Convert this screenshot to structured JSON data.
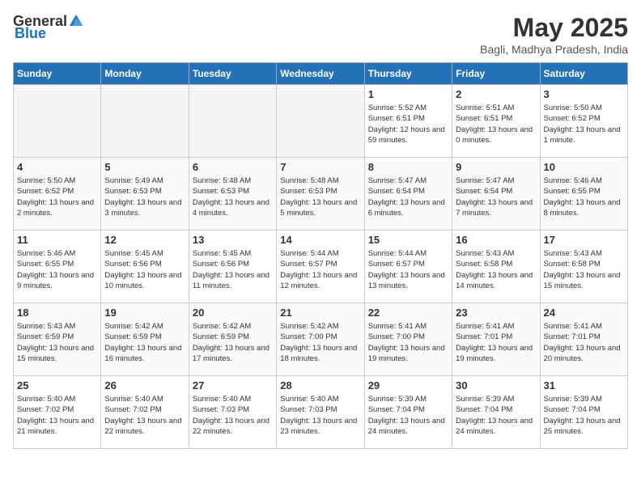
{
  "header": {
    "logo_general": "General",
    "logo_blue": "Blue",
    "month_year": "May 2025",
    "location": "Bagli, Madhya Pradesh, India"
  },
  "weekdays": [
    "Sunday",
    "Monday",
    "Tuesday",
    "Wednesday",
    "Thursday",
    "Friday",
    "Saturday"
  ],
  "weeks": [
    [
      {
        "day": "",
        "empty": true
      },
      {
        "day": "",
        "empty": true
      },
      {
        "day": "",
        "empty": true
      },
      {
        "day": "",
        "empty": true
      },
      {
        "day": "1",
        "sunrise": "5:52 AM",
        "sunset": "6:51 PM",
        "daylight": "12 hours and 59 minutes."
      },
      {
        "day": "2",
        "sunrise": "5:51 AM",
        "sunset": "6:51 PM",
        "daylight": "13 hours and 0 minutes."
      },
      {
        "day": "3",
        "sunrise": "5:50 AM",
        "sunset": "6:52 PM",
        "daylight": "13 hours and 1 minute."
      }
    ],
    [
      {
        "day": "4",
        "sunrise": "5:50 AM",
        "sunset": "6:52 PM",
        "daylight": "13 hours and 2 minutes."
      },
      {
        "day": "5",
        "sunrise": "5:49 AM",
        "sunset": "6:53 PM",
        "daylight": "13 hours and 3 minutes."
      },
      {
        "day": "6",
        "sunrise": "5:48 AM",
        "sunset": "6:53 PM",
        "daylight": "13 hours and 4 minutes."
      },
      {
        "day": "7",
        "sunrise": "5:48 AM",
        "sunset": "6:53 PM",
        "daylight": "13 hours and 5 minutes."
      },
      {
        "day": "8",
        "sunrise": "5:47 AM",
        "sunset": "6:54 PM",
        "daylight": "13 hours and 6 minutes."
      },
      {
        "day": "9",
        "sunrise": "5:47 AM",
        "sunset": "6:54 PM",
        "daylight": "13 hours and 7 minutes."
      },
      {
        "day": "10",
        "sunrise": "5:46 AM",
        "sunset": "6:55 PM",
        "daylight": "13 hours and 8 minutes."
      }
    ],
    [
      {
        "day": "11",
        "sunrise": "5:46 AM",
        "sunset": "6:55 PM",
        "daylight": "13 hours and 9 minutes."
      },
      {
        "day": "12",
        "sunrise": "5:45 AM",
        "sunset": "6:56 PM",
        "daylight": "13 hours and 10 minutes."
      },
      {
        "day": "13",
        "sunrise": "5:45 AM",
        "sunset": "6:56 PM",
        "daylight": "13 hours and 11 minutes."
      },
      {
        "day": "14",
        "sunrise": "5:44 AM",
        "sunset": "6:57 PM",
        "daylight": "13 hours and 12 minutes."
      },
      {
        "day": "15",
        "sunrise": "5:44 AM",
        "sunset": "6:57 PM",
        "daylight": "13 hours and 13 minutes."
      },
      {
        "day": "16",
        "sunrise": "5:43 AM",
        "sunset": "6:58 PM",
        "daylight": "13 hours and 14 minutes."
      },
      {
        "day": "17",
        "sunrise": "5:43 AM",
        "sunset": "6:58 PM",
        "daylight": "13 hours and 15 minutes."
      }
    ],
    [
      {
        "day": "18",
        "sunrise": "5:43 AM",
        "sunset": "6:59 PM",
        "daylight": "13 hours and 15 minutes."
      },
      {
        "day": "19",
        "sunrise": "5:42 AM",
        "sunset": "6:59 PM",
        "daylight": "13 hours and 16 minutes."
      },
      {
        "day": "20",
        "sunrise": "5:42 AM",
        "sunset": "6:59 PM",
        "daylight": "13 hours and 17 minutes."
      },
      {
        "day": "21",
        "sunrise": "5:42 AM",
        "sunset": "7:00 PM",
        "daylight": "13 hours and 18 minutes."
      },
      {
        "day": "22",
        "sunrise": "5:41 AM",
        "sunset": "7:00 PM",
        "daylight": "13 hours and 19 minutes."
      },
      {
        "day": "23",
        "sunrise": "5:41 AM",
        "sunset": "7:01 PM",
        "daylight": "13 hours and 19 minutes."
      },
      {
        "day": "24",
        "sunrise": "5:41 AM",
        "sunset": "7:01 PM",
        "daylight": "13 hours and 20 minutes."
      }
    ],
    [
      {
        "day": "25",
        "sunrise": "5:40 AM",
        "sunset": "7:02 PM",
        "daylight": "13 hours and 21 minutes."
      },
      {
        "day": "26",
        "sunrise": "5:40 AM",
        "sunset": "7:02 PM",
        "daylight": "13 hours and 22 minutes."
      },
      {
        "day": "27",
        "sunrise": "5:40 AM",
        "sunset": "7:03 PM",
        "daylight": "13 hours and 22 minutes."
      },
      {
        "day": "28",
        "sunrise": "5:40 AM",
        "sunset": "7:03 PM",
        "daylight": "13 hours and 23 minutes."
      },
      {
        "day": "29",
        "sunrise": "5:39 AM",
        "sunset": "7:04 PM",
        "daylight": "13 hours and 24 minutes."
      },
      {
        "day": "30",
        "sunrise": "5:39 AM",
        "sunset": "7:04 PM",
        "daylight": "13 hours and 24 minutes."
      },
      {
        "day": "31",
        "sunrise": "5:39 AM",
        "sunset": "7:04 PM",
        "daylight": "13 hours and 25 minutes."
      }
    ]
  ],
  "labels": {
    "sunrise": "Sunrise:",
    "sunset": "Sunset:",
    "daylight": "Daylight hours"
  }
}
